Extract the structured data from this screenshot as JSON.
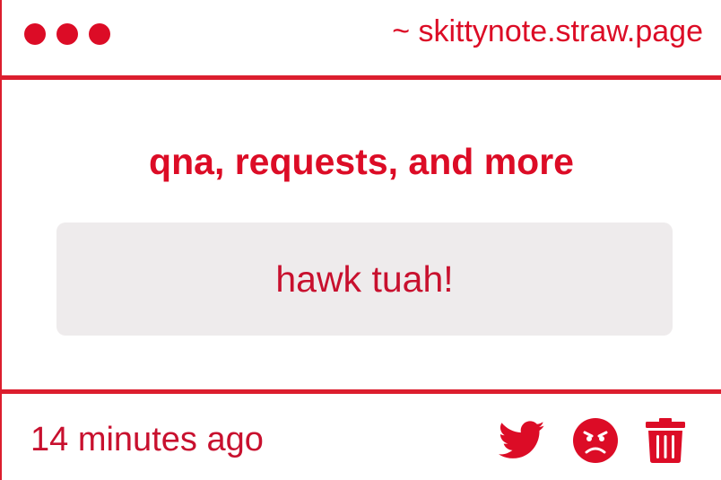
{
  "window": {
    "site": "~ skittynote.straw.page"
  },
  "main": {
    "prompt_title": "qna, requests, and more",
    "answer": "hawk tuah!"
  },
  "footer": {
    "timestamp": "14 minutes ago",
    "actions": [
      {
        "icon": "twitter-icon"
      },
      {
        "icon": "angry-face-icon"
      },
      {
        "icon": "trash-icon"
      }
    ]
  },
  "colors": {
    "accent": "#dc0c26",
    "border": "#dc1e2e",
    "box_background": "#eeebec"
  }
}
